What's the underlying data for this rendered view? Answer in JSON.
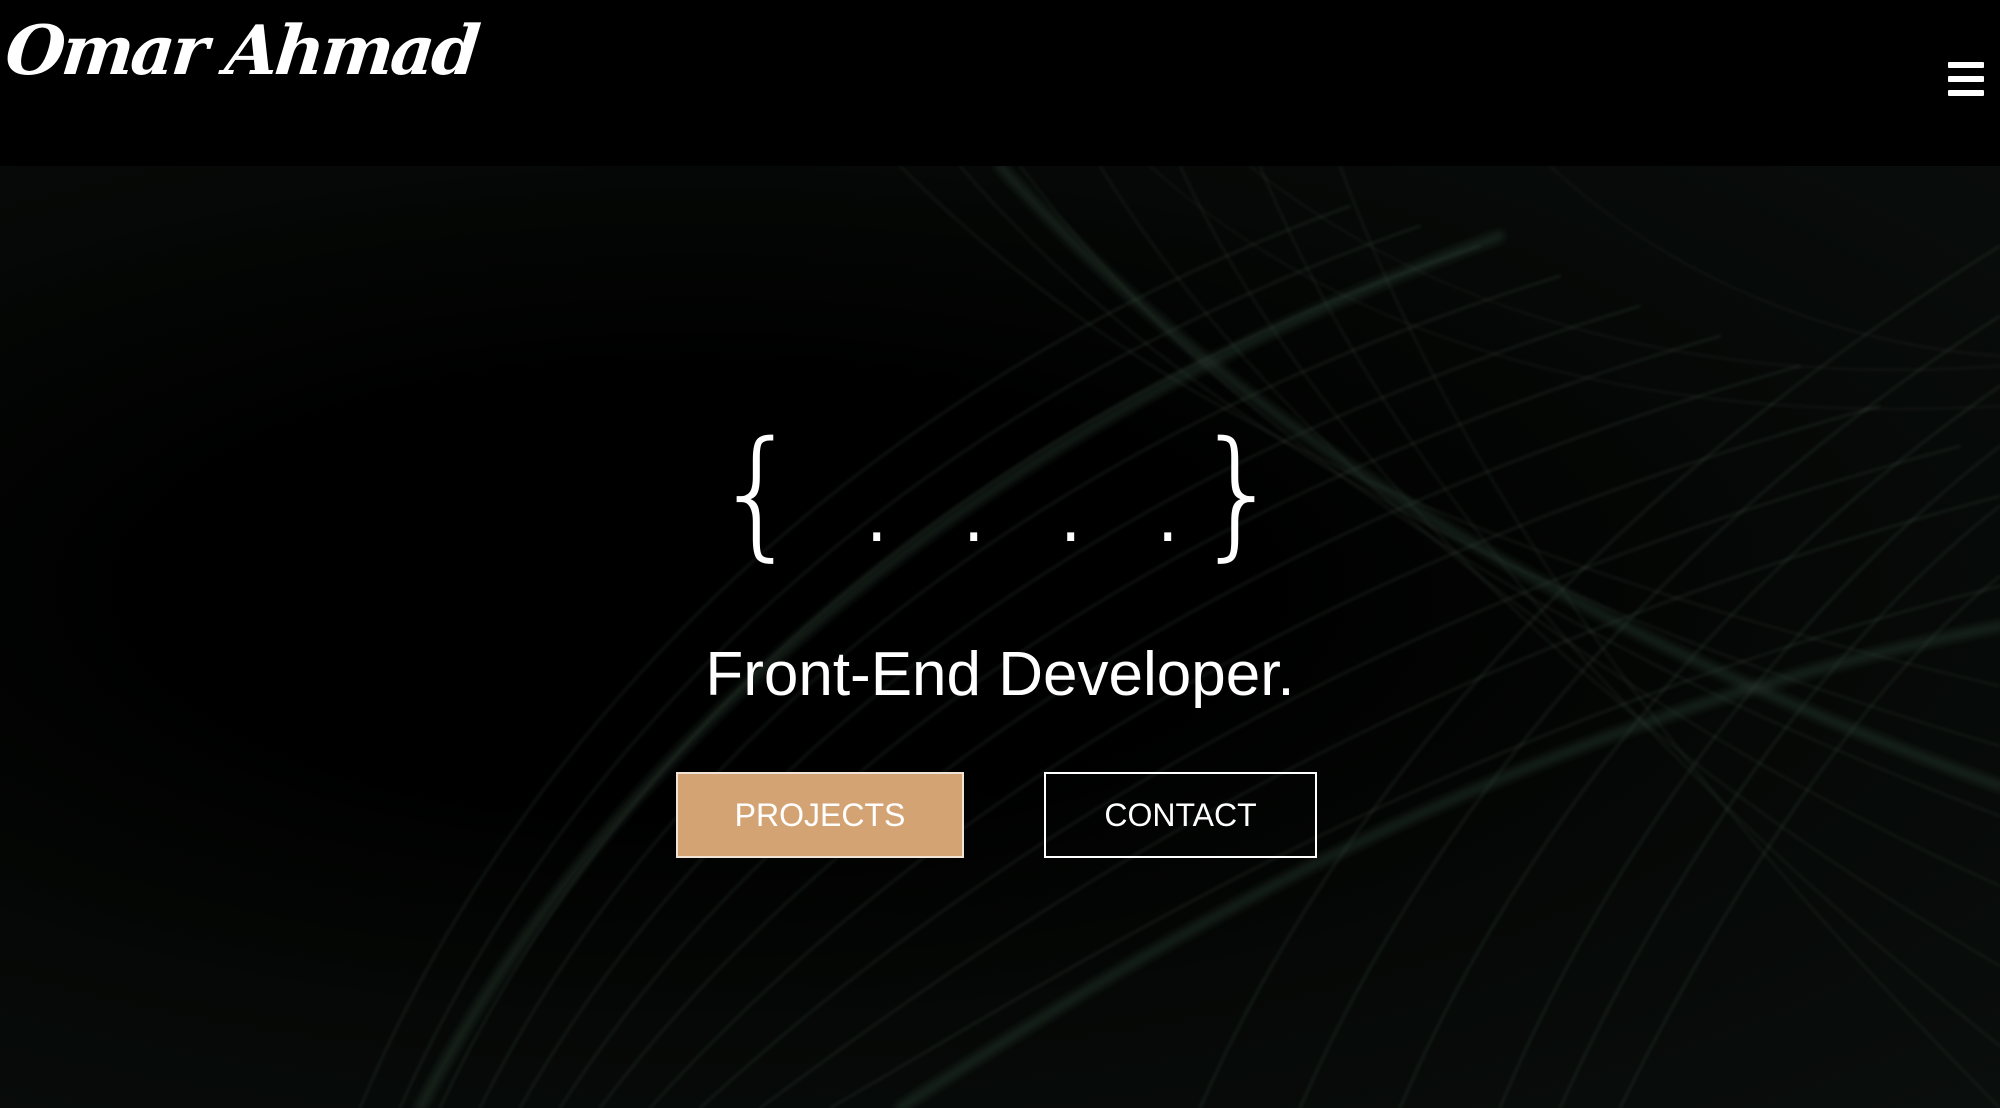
{
  "header": {
    "logo_text": "Omar Ahmad",
    "menu_icon": "hamburger-menu-icon"
  },
  "hero": {
    "code_symbol": "{ . . . .}",
    "subtitle": "Front-End Developer.",
    "buttons": {
      "projects_label": "PROJECTS",
      "contact_label": "CONTACT"
    }
  },
  "colors": {
    "background": "#000000",
    "accent": "#d4a373",
    "text": "#ffffff",
    "wisps": "#2c3a33"
  }
}
